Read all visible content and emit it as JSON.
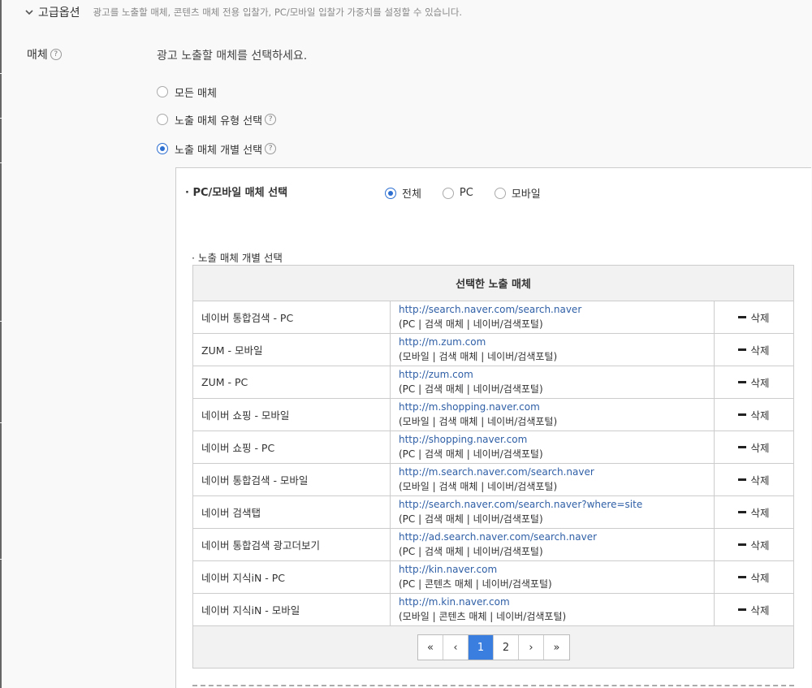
{
  "advanced": {
    "title": "고급옵션",
    "description": "광고를 노출할 매체, 콘텐츠 매체 전용 입찰가, PC/모바일 입찰가 가중치를 설정할 수 있습니다."
  },
  "media": {
    "label": "매체",
    "instruction": "광고 노출할 매체를 선택하세요.",
    "options": [
      {
        "label": "모든 매체",
        "selected": false,
        "help": false
      },
      {
        "label": "노출 매체 유형 선택",
        "selected": false,
        "help": true
      },
      {
        "label": "노출 매체 개별 선택",
        "selected": true,
        "help": true
      }
    ]
  },
  "device": {
    "label": "· PC/모바일 매체 선택",
    "options": [
      {
        "label": "전체",
        "selected": true
      },
      {
        "label": "PC",
        "selected": false
      },
      {
        "label": "모바일",
        "selected": false
      }
    ]
  },
  "individual": {
    "label": "· 노출 매체 개별 선택",
    "table_header": "선택한 노출 매체",
    "delete_label": "삭제",
    "rows": [
      {
        "name": "네이버 통합검색 - PC",
        "url": "http://search.naver.com/search.naver",
        "meta": "(PC | 검색 매체 | 네이버/검색포털)"
      },
      {
        "name": "ZUM - 모바일",
        "url": "http://m.zum.com",
        "meta": "(모바일 | 검색 매체 | 네이버/검색포털)"
      },
      {
        "name": "ZUM - PC",
        "url": "http://zum.com",
        "meta": "(PC | 검색 매체 | 네이버/검색포털)"
      },
      {
        "name": "네이버 쇼핑 - 모바일",
        "url": "http://m.shopping.naver.com",
        "meta": "(모바일 | 검색 매체 | 네이버/검색포털)"
      },
      {
        "name": "네이버 쇼핑 - PC",
        "url": "http://shopping.naver.com",
        "meta": "(PC | 검색 매체 | 네이버/검색포털)"
      },
      {
        "name": "네이버 통합검색 - 모바일",
        "url": "http://m.search.naver.com/search.naver",
        "meta": "(모바일 | 검색 매체 | 네이버/검색포털)"
      },
      {
        "name": "네이버 검색탭",
        "url": "http://search.naver.com/search.naver?where=site",
        "meta": "(PC | 검색 매체 | 네이버/검색포털)"
      },
      {
        "name": "네이버 통합검색 광고더보기",
        "url": "http://ad.search.naver.com/search.naver",
        "meta": "(PC | 검색 매체 | 네이버/검색포털)"
      },
      {
        "name": "네이버 지식iN - PC",
        "url": "http://kin.naver.com",
        "meta": "(PC | 콘텐츠 매체 | 네이버/검색포털)"
      },
      {
        "name": "네이버 지식iN - 모바일",
        "url": "http://m.kin.naver.com",
        "meta": "(모바일 | 콘텐츠 매체 | 네이버/검색포털)"
      }
    ]
  },
  "pagination": {
    "first": "«",
    "prev": "‹",
    "pages": [
      "1",
      "2"
    ],
    "current": "1",
    "next": "›",
    "last": "»"
  },
  "colors": {
    "accent": "#3a7ee0",
    "link": "#2f5fa6"
  }
}
